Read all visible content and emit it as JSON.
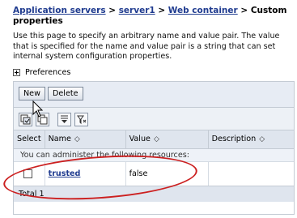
{
  "breadcrumb": {
    "app_servers": "Application servers",
    "sep1": " > ",
    "server": "server1",
    "sep2": " > ",
    "web_container": "Web container",
    "sep3": " > ",
    "current": "Custom properties"
  },
  "description": "Use this page to specify an arbitrary name and value pair. The value that is specified for the name and value pair is a string that can set internal system configuration properties.",
  "preferences": {
    "label": "Preferences",
    "icon": "plus-box-icon"
  },
  "toolbar": {
    "new_label": "New",
    "delete_label": "Delete"
  },
  "icon_toolbar": [
    {
      "name": "select-all-icon"
    },
    {
      "name": "deselect-all-icon"
    },
    {
      "name": "show-filter-icon"
    },
    {
      "name": "clear-filter-icon"
    }
  ],
  "table": {
    "headers": {
      "select": "Select",
      "name": "Name",
      "value": "Value",
      "description": "Description"
    },
    "sort_glyph": "◇",
    "admin_text": "You can administer the following resources:",
    "rows": [
      {
        "name": "trusted",
        "value": "false",
        "description": ""
      }
    ],
    "total": "Total 1"
  },
  "colors": {
    "link": "#1f3b8f",
    "highlight_ellipse": "#cc2020",
    "header_bg": "#dfe5ee"
  }
}
